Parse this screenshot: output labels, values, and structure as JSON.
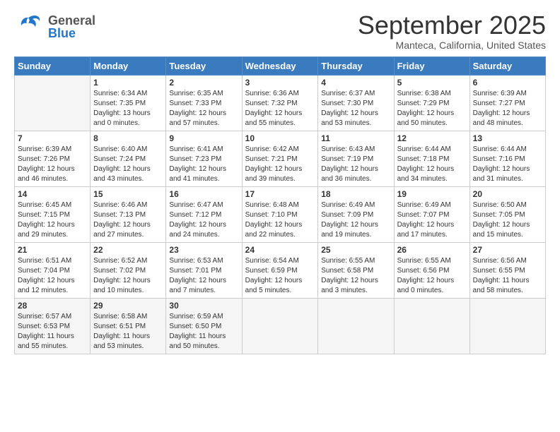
{
  "header": {
    "logo_general": "General",
    "logo_blue": "Blue",
    "month_title": "September 2025",
    "location": "Manteca, California, United States"
  },
  "weekdays": [
    "Sunday",
    "Monday",
    "Tuesday",
    "Wednesday",
    "Thursday",
    "Friday",
    "Saturday"
  ],
  "weeks": [
    [
      {
        "day": "",
        "info": ""
      },
      {
        "day": "1",
        "info": "Sunrise: 6:34 AM\nSunset: 7:35 PM\nDaylight: 13 hours\nand 0 minutes."
      },
      {
        "day": "2",
        "info": "Sunrise: 6:35 AM\nSunset: 7:33 PM\nDaylight: 12 hours\nand 57 minutes."
      },
      {
        "day": "3",
        "info": "Sunrise: 6:36 AM\nSunset: 7:32 PM\nDaylight: 12 hours\nand 55 minutes."
      },
      {
        "day": "4",
        "info": "Sunrise: 6:37 AM\nSunset: 7:30 PM\nDaylight: 12 hours\nand 53 minutes."
      },
      {
        "day": "5",
        "info": "Sunrise: 6:38 AM\nSunset: 7:29 PM\nDaylight: 12 hours\nand 50 minutes."
      },
      {
        "day": "6",
        "info": "Sunrise: 6:39 AM\nSunset: 7:27 PM\nDaylight: 12 hours\nand 48 minutes."
      }
    ],
    [
      {
        "day": "7",
        "info": "Sunrise: 6:39 AM\nSunset: 7:26 PM\nDaylight: 12 hours\nand 46 minutes."
      },
      {
        "day": "8",
        "info": "Sunrise: 6:40 AM\nSunset: 7:24 PM\nDaylight: 12 hours\nand 43 minutes."
      },
      {
        "day": "9",
        "info": "Sunrise: 6:41 AM\nSunset: 7:23 PM\nDaylight: 12 hours\nand 41 minutes."
      },
      {
        "day": "10",
        "info": "Sunrise: 6:42 AM\nSunset: 7:21 PM\nDaylight: 12 hours\nand 39 minutes."
      },
      {
        "day": "11",
        "info": "Sunrise: 6:43 AM\nSunset: 7:19 PM\nDaylight: 12 hours\nand 36 minutes."
      },
      {
        "day": "12",
        "info": "Sunrise: 6:44 AM\nSunset: 7:18 PM\nDaylight: 12 hours\nand 34 minutes."
      },
      {
        "day": "13",
        "info": "Sunrise: 6:44 AM\nSunset: 7:16 PM\nDaylight: 12 hours\nand 31 minutes."
      }
    ],
    [
      {
        "day": "14",
        "info": "Sunrise: 6:45 AM\nSunset: 7:15 PM\nDaylight: 12 hours\nand 29 minutes."
      },
      {
        "day": "15",
        "info": "Sunrise: 6:46 AM\nSunset: 7:13 PM\nDaylight: 12 hours\nand 27 minutes."
      },
      {
        "day": "16",
        "info": "Sunrise: 6:47 AM\nSunset: 7:12 PM\nDaylight: 12 hours\nand 24 minutes."
      },
      {
        "day": "17",
        "info": "Sunrise: 6:48 AM\nSunset: 7:10 PM\nDaylight: 12 hours\nand 22 minutes."
      },
      {
        "day": "18",
        "info": "Sunrise: 6:49 AM\nSunset: 7:09 PM\nDaylight: 12 hours\nand 19 minutes."
      },
      {
        "day": "19",
        "info": "Sunrise: 6:49 AM\nSunset: 7:07 PM\nDaylight: 12 hours\nand 17 minutes."
      },
      {
        "day": "20",
        "info": "Sunrise: 6:50 AM\nSunset: 7:05 PM\nDaylight: 12 hours\nand 15 minutes."
      }
    ],
    [
      {
        "day": "21",
        "info": "Sunrise: 6:51 AM\nSunset: 7:04 PM\nDaylight: 12 hours\nand 12 minutes."
      },
      {
        "day": "22",
        "info": "Sunrise: 6:52 AM\nSunset: 7:02 PM\nDaylight: 12 hours\nand 10 minutes."
      },
      {
        "day": "23",
        "info": "Sunrise: 6:53 AM\nSunset: 7:01 PM\nDaylight: 12 hours\nand 7 minutes."
      },
      {
        "day": "24",
        "info": "Sunrise: 6:54 AM\nSunset: 6:59 PM\nDaylight: 12 hours\nand 5 minutes."
      },
      {
        "day": "25",
        "info": "Sunrise: 6:55 AM\nSunset: 6:58 PM\nDaylight: 12 hours\nand 3 minutes."
      },
      {
        "day": "26",
        "info": "Sunrise: 6:55 AM\nSunset: 6:56 PM\nDaylight: 12 hours\nand 0 minutes."
      },
      {
        "day": "27",
        "info": "Sunrise: 6:56 AM\nSunset: 6:55 PM\nDaylight: 11 hours\nand 58 minutes."
      }
    ],
    [
      {
        "day": "28",
        "info": "Sunrise: 6:57 AM\nSunset: 6:53 PM\nDaylight: 11 hours\nand 55 minutes."
      },
      {
        "day": "29",
        "info": "Sunrise: 6:58 AM\nSunset: 6:51 PM\nDaylight: 11 hours\nand 53 minutes."
      },
      {
        "day": "30",
        "info": "Sunrise: 6:59 AM\nSunset: 6:50 PM\nDaylight: 11 hours\nand 50 minutes."
      },
      {
        "day": "",
        "info": ""
      },
      {
        "day": "",
        "info": ""
      },
      {
        "day": "",
        "info": ""
      },
      {
        "day": "",
        "info": ""
      }
    ]
  ]
}
